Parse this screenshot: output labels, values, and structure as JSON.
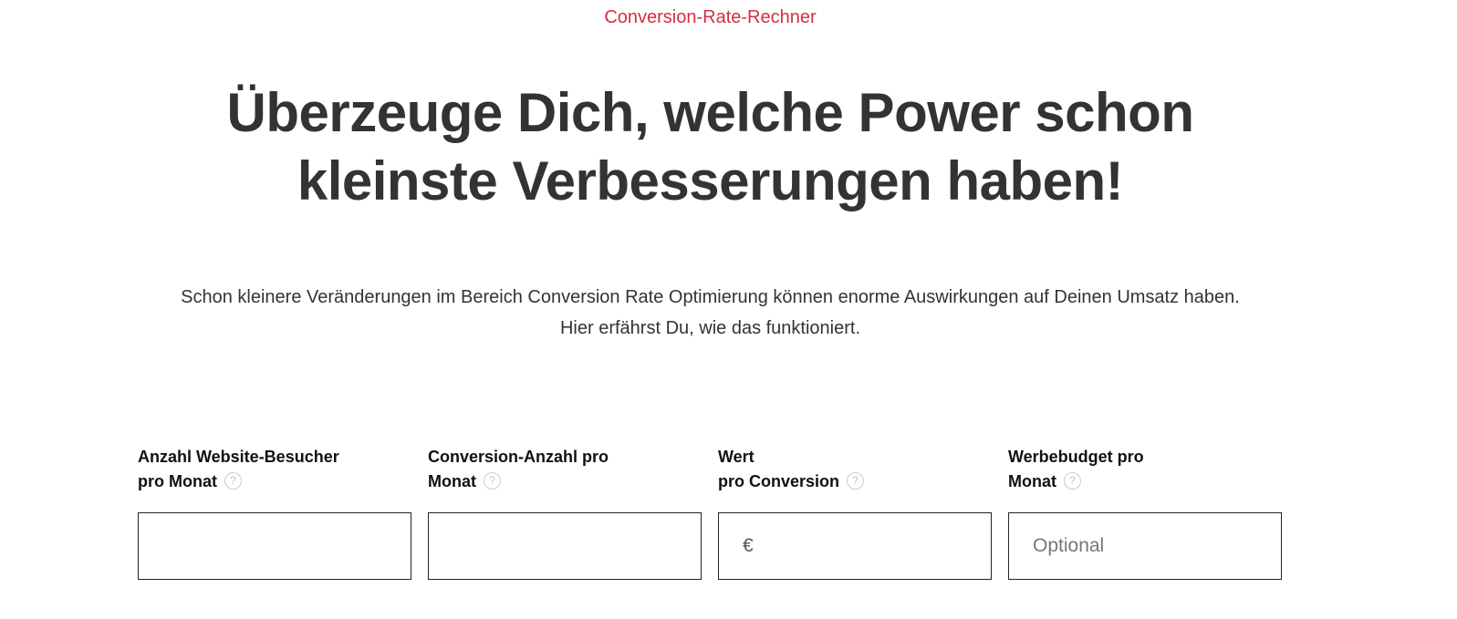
{
  "header": {
    "eyebrow": "Conversion-Rate-Rechner",
    "headline_line1": "Überzeuge Dich, welche Power schon",
    "headline_line2": "kleinste Verbesserungen haben!"
  },
  "intro": {
    "line1": "Schon kleinere Veränderungen im Bereich Conversion Rate Optimierung können enorme Auswirkungen auf Deinen Umsatz haben.",
    "line2": "Hier erfährst Du, wie das funktioniert."
  },
  "fields": {
    "visitors": {
      "label_line1": "Anzahl Website-Besucher",
      "label_line2": "pro Monat",
      "value": "",
      "placeholder": ""
    },
    "conversions": {
      "label_line1": "Conversion-Anzahl pro",
      "label_line2": "Monat",
      "value": "",
      "placeholder": ""
    },
    "value_per_conversion": {
      "label_line1": "Wert",
      "label_line2": "pro Conversion",
      "currency_symbol": "€",
      "value": "",
      "placeholder": ""
    },
    "ad_budget": {
      "label_line1": "Werbebudget pro",
      "label_line2": "Monat",
      "value": "",
      "placeholder": "Optional"
    }
  },
  "icons": {
    "help": "question-circle-icon"
  },
  "colors": {
    "accent": "#d32f3f",
    "text": "#333333",
    "border": "#222222"
  }
}
